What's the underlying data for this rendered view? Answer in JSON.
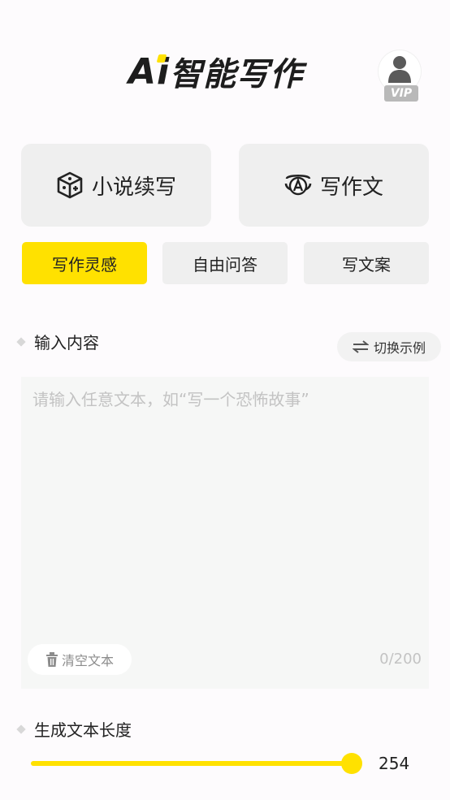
{
  "header": {
    "logo_ai": "Ai",
    "logo_text": "智能写作",
    "vip_badge": "VIP"
  },
  "modes": [
    {
      "label": "小说续写",
      "icon": "dice-book-icon"
    },
    {
      "label": "写作文",
      "icon": "essay-a-icon"
    }
  ],
  "tabs": [
    {
      "label": "写作灵感",
      "active": true
    },
    {
      "label": "自由问答",
      "active": false
    },
    {
      "label": "写文案",
      "active": false
    }
  ],
  "input_section": {
    "label": "输入内容",
    "switch_example_label": "切换示例",
    "placeholder": "请输入任意文本，如“写一个恐怖故事”",
    "value": "",
    "clear_label": "清空文本",
    "counter": "0/200"
  },
  "length_section": {
    "label": "生成文本长度",
    "value": "254"
  },
  "colors": {
    "accent": "#ffe100",
    "card_bg": "#efefef",
    "textarea_bg": "#f6f7f6",
    "placeholder": "#c3c3c3"
  }
}
